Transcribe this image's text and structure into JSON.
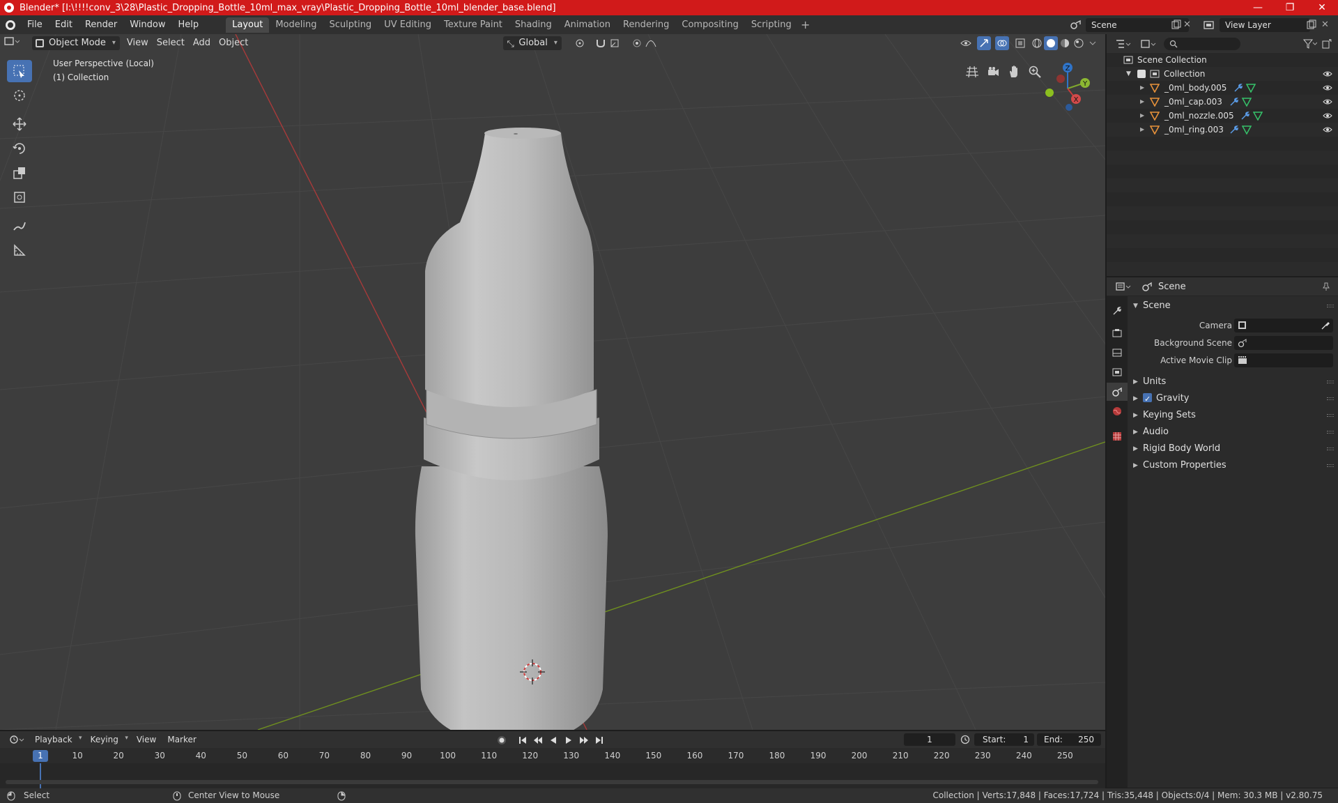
{
  "window": {
    "title": "Blender* [I:\\!!!!conv_3\\28\\Plastic_Dropping_Bottle_10ml_max_vray\\Plastic_Dropping_Bottle_10ml_blender_base.blend]",
    "minimize": "—",
    "maximize": "❐",
    "close": "✕"
  },
  "menu": {
    "items": [
      "File",
      "Edit",
      "Render",
      "Window",
      "Help"
    ],
    "workspaces": [
      "Layout",
      "Modeling",
      "Sculpting",
      "UV Editing",
      "Texture Paint",
      "Shading",
      "Animation",
      "Rendering",
      "Compositing",
      "Scripting"
    ],
    "active_workspace": "Layout",
    "add_workspace": "+",
    "scene": "Scene",
    "view_layer": "View Layer"
  },
  "viewport": {
    "mode": "Object Mode",
    "menus": [
      "View",
      "Select",
      "Add",
      "Object"
    ],
    "orientation": "Global",
    "perspective_label": "User Perspective (Local)",
    "collection_label": "(1) Collection",
    "gizmo": {
      "z": "Z",
      "y": "Y",
      "x": "X"
    },
    "colors": {
      "x_axis": "#a83a3a",
      "y_axis": "#6f8f1f",
      "z_axis": "#2f74c9",
      "background": "#3d3d3d"
    }
  },
  "outliner": {
    "root": "Scene Collection",
    "collection": "Collection",
    "objects": [
      "_0ml_body.005",
      "_0ml_cap.003",
      "_0ml_nozzle.005",
      "_0ml_ring.003"
    ]
  },
  "properties": {
    "context": "Scene",
    "panel": "Scene",
    "fields": [
      {
        "label": "Camera",
        "value": ""
      },
      {
        "label": "Background Scene",
        "value": ""
      },
      {
        "label": "Active Movie Clip",
        "value": ""
      }
    ],
    "subpanels": [
      "Units",
      "Gravity",
      "Keying Sets",
      "Audio",
      "Rigid Body World",
      "Custom Properties"
    ],
    "gravity_checked": true
  },
  "timeline": {
    "menus": [
      "Playback",
      "Keying",
      "View",
      "Marker"
    ],
    "current_frame": "1",
    "start_label": "Start:",
    "start": "1",
    "end_label": "End:",
    "end": "250",
    "ticks": [
      "10",
      "20",
      "30",
      "40",
      "50",
      "60",
      "70",
      "80",
      "90",
      "100",
      "110",
      "120",
      "130",
      "140",
      "150",
      "160",
      "170",
      "180",
      "190",
      "200",
      "210",
      "220",
      "230",
      "240",
      "250"
    ],
    "cursor_label": "1"
  },
  "statusbar": {
    "left": "Select",
    "middle": "Center View to Mouse",
    "right": "Collection | Verts:17,848 | Faces:17,724 | Tris:35,448 | Objects:0/4 | Mem: 30.3 MB | v2.80.75"
  }
}
